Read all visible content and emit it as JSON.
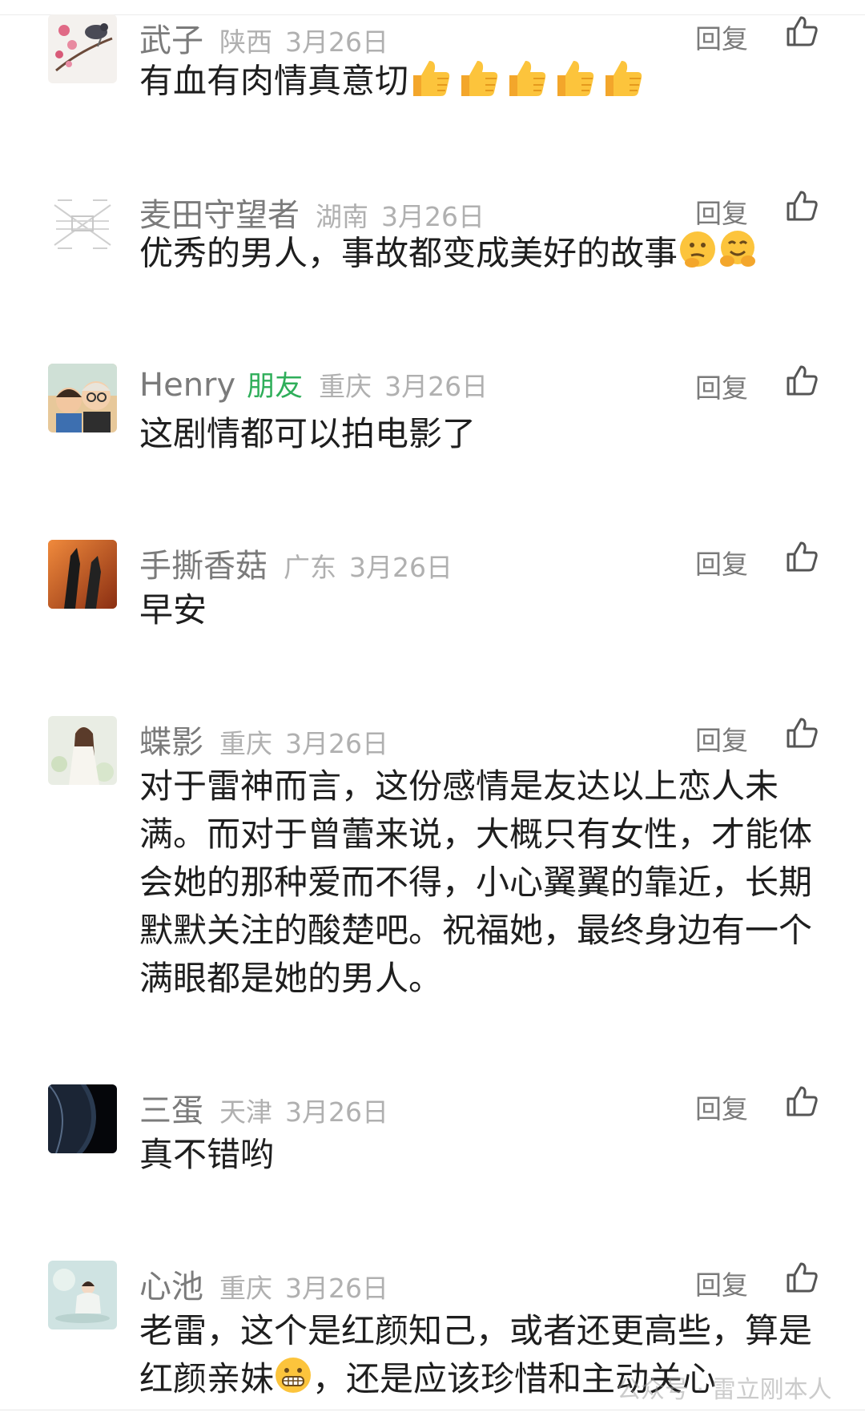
{
  "reply_label": "回复",
  "comments": [
    {
      "name": "武子",
      "region": "陕西",
      "date": "3月26日",
      "text": "有血有肉情真意切",
      "emoji": "thumbs-up-x5"
    },
    {
      "name": "麦田守望者",
      "region": "湖南",
      "date": "3月26日",
      "text": "优秀的男人，事故都变成美好的故事",
      "emoji": "thinking-face, hugging-face"
    },
    {
      "name": "Henry",
      "badge": "朋友",
      "region": "重庆",
      "date": "3月26日",
      "text": "这剧情都可以拍电影了"
    },
    {
      "name": "手撕香菇",
      "region": "广东",
      "date": "3月26日",
      "text": "早安"
    },
    {
      "name": "蝶影",
      "region": "重庆",
      "date": "3月26日",
      "text": "对于雷神而言，这份感情是友达以上恋人未满。而对于曾蕾来说，大概只有女性，才能体会她的那种爱而不得，小心翼翼的靠近，长期默默关注的酸楚吧。祝福她，最终身边有一个满眼都是她的男人。"
    },
    {
      "name": "三蛋",
      "region": "天津",
      "date": "3月26日",
      "text": "真不错哟"
    },
    {
      "name": "心池",
      "region": "重庆",
      "date": "3月26日",
      "text_part1": "老雷，这个是红颜知己，或者还更高些，算是红颜亲妹",
      "text_part2": "，还是应该珍惜和主动关心",
      "emoji": "grinning-face"
    }
  ],
  "watermark": "公众号 · 雷立刚本人"
}
